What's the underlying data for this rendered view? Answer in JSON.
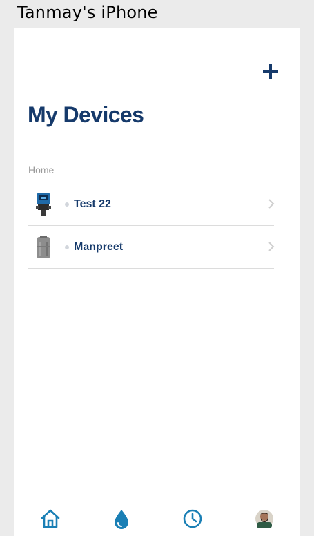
{
  "window": {
    "title": "Tanmay's iPhone"
  },
  "header": {
    "add_icon": "plus-icon",
    "title": "My Devices"
  },
  "section": {
    "label": "Home"
  },
  "devices": [
    {
      "name": "Test 22",
      "thumb_icon": "water-softener-controller-image"
    },
    {
      "name": "Manpreet",
      "thumb_icon": "water-tank-image"
    }
  ],
  "tabbar": {
    "items": [
      {
        "icon": "home-icon"
      },
      {
        "icon": "water-drop-icon"
      },
      {
        "icon": "clock-icon"
      },
      {
        "icon": "profile-avatar"
      }
    ]
  },
  "colors": {
    "primary": "#163a6b",
    "accent": "#1a7fb5",
    "background": "#ebebeb"
  }
}
